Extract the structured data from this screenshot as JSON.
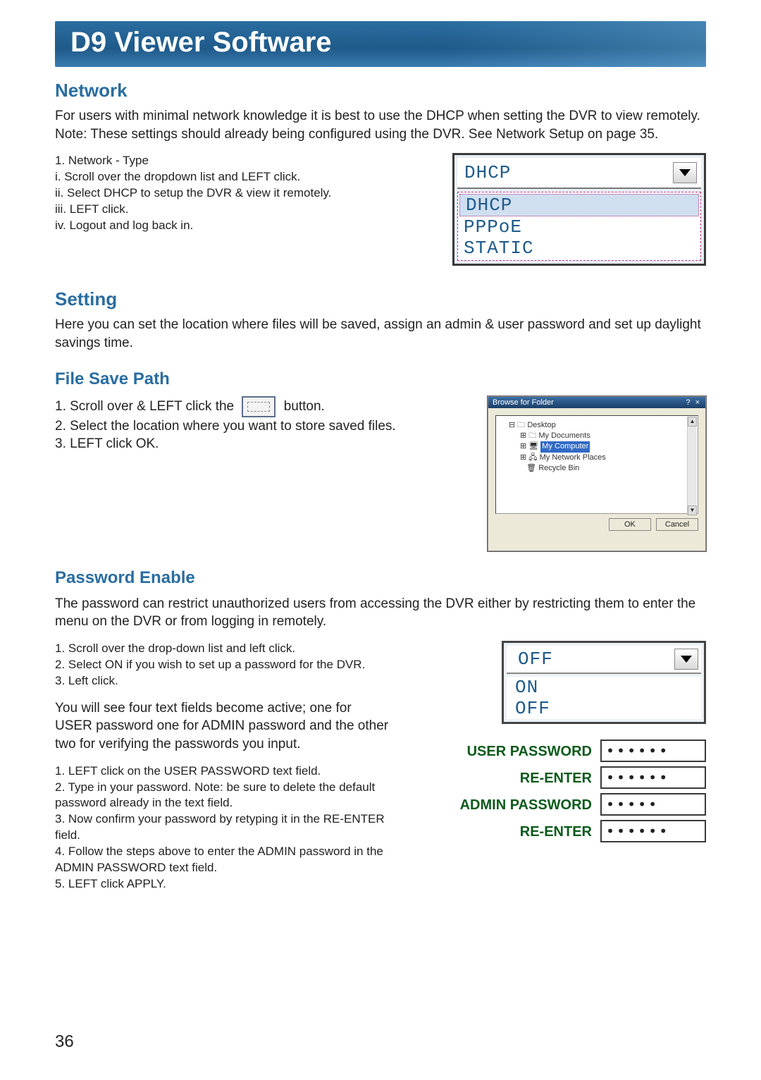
{
  "page": {
    "title": "D9 Viewer Software",
    "number": "36"
  },
  "network": {
    "heading": "Network",
    "intro": "For users with minimal network knowledge it is best to use the DHCP when setting the DVR to view remotely. Note: These settings should already being configured using the DVR. See Network Setup on page 35.",
    "steps_title": "1. Network - Type",
    "step_i": "i. Scroll over the dropdown list and LEFT click.",
    "step_ii": "ii. Select DHCP to setup the DVR & view it remotely.",
    "step_iii": "iii. LEFT click.",
    "step_iv": "iv. Logout and log back in.",
    "dropdown": {
      "selected": "DHCP",
      "option1": "DHCP",
      "option2": "PPPoE",
      "option3": "STATIC"
    }
  },
  "setting": {
    "heading": "Setting",
    "intro": "Here you can set the location where files will be saved, assign an admin & user password and set up daylight savings time."
  },
  "filesave": {
    "heading": "File Save Path",
    "step1_pre": "1. Scroll over & LEFT click the",
    "step1_post": "button.",
    "step2": "2. Select the location where you want to store saved files.",
    "step3": "3. LEFT click OK.",
    "browse": {
      "title": "Browse for Folder",
      "node1": "Desktop",
      "node2": "My Documents",
      "node3": "My Computer",
      "node4": "My Network Places",
      "node5": "Recycle Bin",
      "ok": "OK",
      "cancel": "Cancel"
    }
  },
  "password": {
    "heading": "Password Enable",
    "intro": "The password can restrict unauthorized users from accessing the DVR either by restricting them to enter the menu on the DVR or from logging in remotely.",
    "step1": "1. Scroll over the drop-down list and left click.",
    "step2": "2. Select ON if you wish to set up a password for the DVR.",
    "step3": "3. Left click.",
    "middle": "You will see four text fields become active; one for USER password one for ADMIN password and the other two for verifying the passwords you input.",
    "p1": "1. LEFT click on the USER PASSWORD text field.",
    "p2": "2. Type in your password. Note: be sure to delete the default password already in the text field.",
    "p3": "3. Now confirm your password by retyping it in the RE-ENTER field.",
    "p4": "4. Follow the steps above to enter the ADMIN password in the ADMIN PASSWORD text field.",
    "p5": "5. LEFT click APPLY.",
    "dropdown": {
      "selected": "OFF",
      "option1": "ON",
      "option2": "OFF"
    },
    "fields": {
      "user_label": "USER PASSWORD",
      "reenter_label": "RE-ENTER",
      "admin_label": "ADMIN PASSWORD",
      "user_val": "••••••",
      "user_re_val": "••••••",
      "admin_val": "•••••",
      "admin_re_val": "••••••"
    }
  }
}
